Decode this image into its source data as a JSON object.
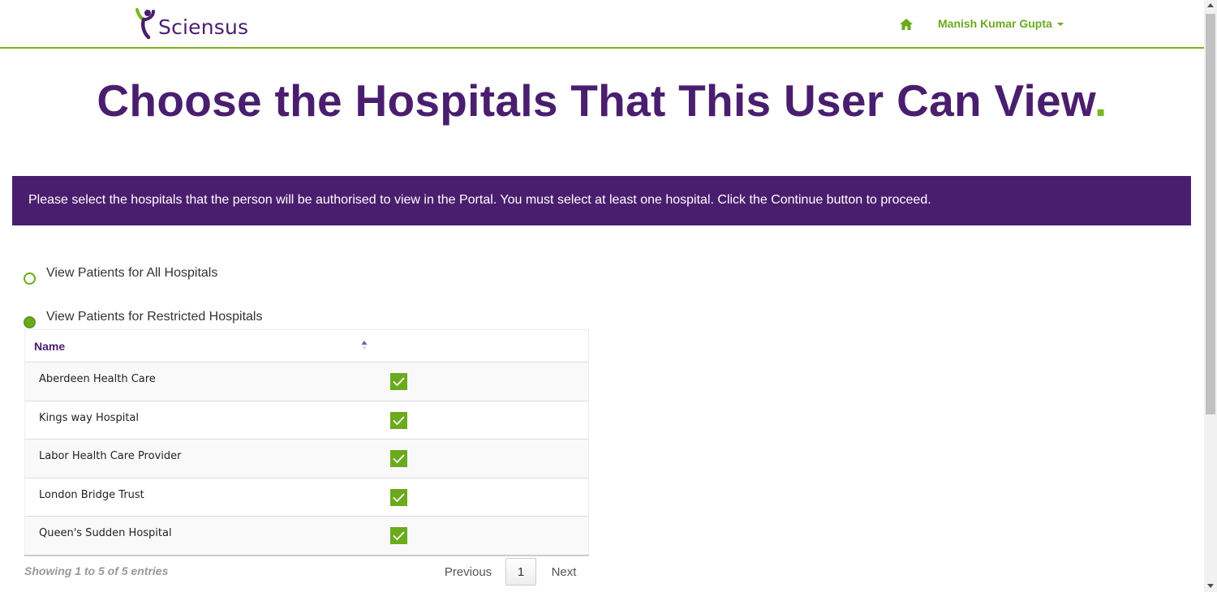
{
  "header": {
    "logo_text": "Sciensus",
    "user_name": "Manish Kumar Gupta"
  },
  "page": {
    "title": "Choose the Hospitals That This User Can View",
    "title_dot": "."
  },
  "banner": {
    "text": "Please select the hospitals that the person will be authorised to view in the Portal. You must select at least one hospital. Click the Continue button to proceed."
  },
  "options": {
    "all": {
      "label": "View Patients for All Hospitals",
      "checked": false
    },
    "restricted": {
      "label": "View Patients for Restricted Hospitals",
      "checked": true
    }
  },
  "table": {
    "column_name": "Name",
    "rows": [
      {
        "name": "Aberdeen Health Care",
        "checked": true
      },
      {
        "name": "Kings way Hospital",
        "checked": true
      },
      {
        "name": "Labor Health Care Provider",
        "checked": true
      },
      {
        "name": "London Bridge Trust",
        "checked": true
      },
      {
        "name": "Queen's Sudden Hospital",
        "checked": true
      }
    ]
  },
  "footer": {
    "info": "Showing 1 to 5 of 5 entries",
    "previous": "Previous",
    "page": "1",
    "next": "Next"
  },
  "colors": {
    "brand_purple": "#4a1e6e",
    "brand_green": "#6aaa1d"
  },
  "icons": {
    "home": "home-icon",
    "caret": "caret-down-icon",
    "sort": "sort-icon",
    "check": "check-icon"
  }
}
